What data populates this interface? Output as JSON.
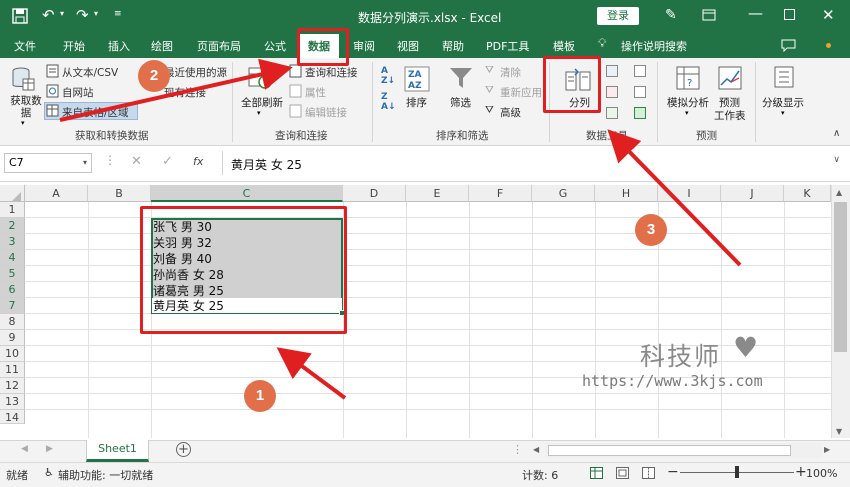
{
  "titlebar": {
    "file": "数据分列演示.xlsx - Excel",
    "login": "登录"
  },
  "tabs": [
    "文件",
    "开始",
    "插入",
    "绘图",
    "页面布局",
    "公式",
    "数据",
    "审阅",
    "视图",
    "帮助",
    "PDF工具",
    "模板",
    "操作说明搜索"
  ],
  "ribbon": {
    "get_data": "获取数\n据",
    "from_text": "从文本/CSV",
    "from_web": "自网站",
    "from_table": "来自表格/区域",
    "recent": "最近使用的源",
    "existing": "现有连接",
    "group_get": "获取和转换数据",
    "refresh_all": "全部刷新",
    "queries": "查询和连接",
    "properties": "属性",
    "edit_links": "编辑链接",
    "group_query": "查询和连接",
    "sort": "排序",
    "filter": "筛选",
    "clear": "清除",
    "reapply": "重新应用",
    "advanced": "高级",
    "group_sort": "排序和筛选",
    "text_to_columns": "分列",
    "group_data_tools": "数据工具",
    "whatif": "模拟分析",
    "forecast_sheet_1": "预测",
    "forecast_sheet_2": "工作表",
    "group_forecast": "预测",
    "outline": "分级显示"
  },
  "formula_bar": {
    "name_box": "C7",
    "fx": "fx",
    "value": "黄月英 女 25"
  },
  "columns": [
    "A",
    "B",
    "C",
    "D",
    "E",
    "F",
    "G",
    "H",
    "I",
    "J",
    "K"
  ],
  "rows": [
    "1",
    "2",
    "3",
    "4",
    "5",
    "6",
    "7",
    "8",
    "9",
    "10",
    "11",
    "12",
    "13",
    "14"
  ],
  "cells": [
    "张飞 男 30",
    "关羽 男 32",
    "刘备 男 40",
    "孙尚香 女 28",
    "诸葛亮 男 25",
    "黄月英 女 25"
  ],
  "sheet_tab": "Sheet1",
  "status": {
    "ready": "就绪",
    "accessibility": "辅助功能: 一切就绪",
    "count": "计数: 6",
    "zoom": "100%"
  },
  "watermark": {
    "brand": "科技师",
    "url": "https://www.3kjs.com"
  },
  "annotations": [
    "1",
    "2",
    "3"
  ],
  "colors": {
    "excel_green": "#217346",
    "annotation_red": "#e02020",
    "badge_orange": "#e1704a"
  }
}
